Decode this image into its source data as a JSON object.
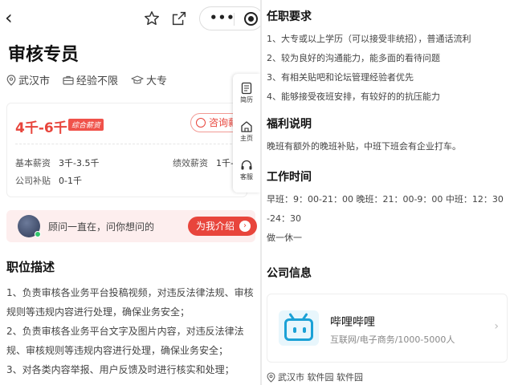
{
  "left": {
    "back_glyph": "‹",
    "job_title": "审核专员",
    "tags": {
      "location": "武汉市",
      "experience": "经验不限",
      "education": "大专"
    },
    "salary": {
      "range": "4千-6千",
      "badge": "综合薪资",
      "consult_label": "咨询薪",
      "base_label": "基本薪资",
      "base_value": "3千-3.5千",
      "perf_label": "绩效薪资",
      "perf_value": "1千-",
      "subsidy_label": "公司补贴",
      "subsidy_value": "0-1千"
    },
    "side_float": {
      "resume": "简历",
      "home": "主页",
      "service": "客服"
    },
    "advisor": {
      "text": "顾问一直在，问你想问的",
      "button": "为我介绍",
      "button_arrow": "›"
    },
    "desc_title": "职位描述",
    "desc_lines": [
      "1、负责审核各业务平台投稿视频，对违反法律法规、审核",
      "规则等违规内容进行处理，确保业务安全；",
      "2、负责审核各业务平台文字及图片内容，对违反法律法",
      "规、审核规则等违规内容进行处理，确保业务安全；",
      "3、对各类内容举报、用户反馈及时进行核实和处理；"
    ]
  },
  "right": {
    "req_title": "任职要求",
    "req_lines": [
      "1、大专或以上学历（可以接受非统招），普通话流利",
      "2、较为良好的沟通能力，能多面的看待问题",
      "3、有相关贴吧和论坛管理经验者优先",
      "4、能够接受夜班安排，有较好的的抗压能力"
    ],
    "benefit_title": "福利说明",
    "benefit_line": "晚班有额外的晚班补贴，中班下班会有企业打车。",
    "time_title": "工作时间",
    "time_lines": [
      "早班：9：00-21：00 晚班：21：00-9：00 中班：12：30",
      "-24：30",
      "做一休一"
    ],
    "company_title": "公司信息",
    "company": {
      "name": "哔哩哔哩",
      "sub": "互联网/电子商务/1000-5000人",
      "arrow": "›"
    },
    "address": "武汉市 软件园 软件园"
  },
  "colors": {
    "accent": "#e8453c",
    "brand_blue": "#1ba1d6"
  },
  "icons": [
    "back-icon",
    "star-icon",
    "share-icon",
    "more-icon",
    "target-icon",
    "location-icon",
    "briefcase-icon",
    "graduation-cap-icon",
    "resume-icon",
    "home-icon",
    "headset-icon"
  ]
}
